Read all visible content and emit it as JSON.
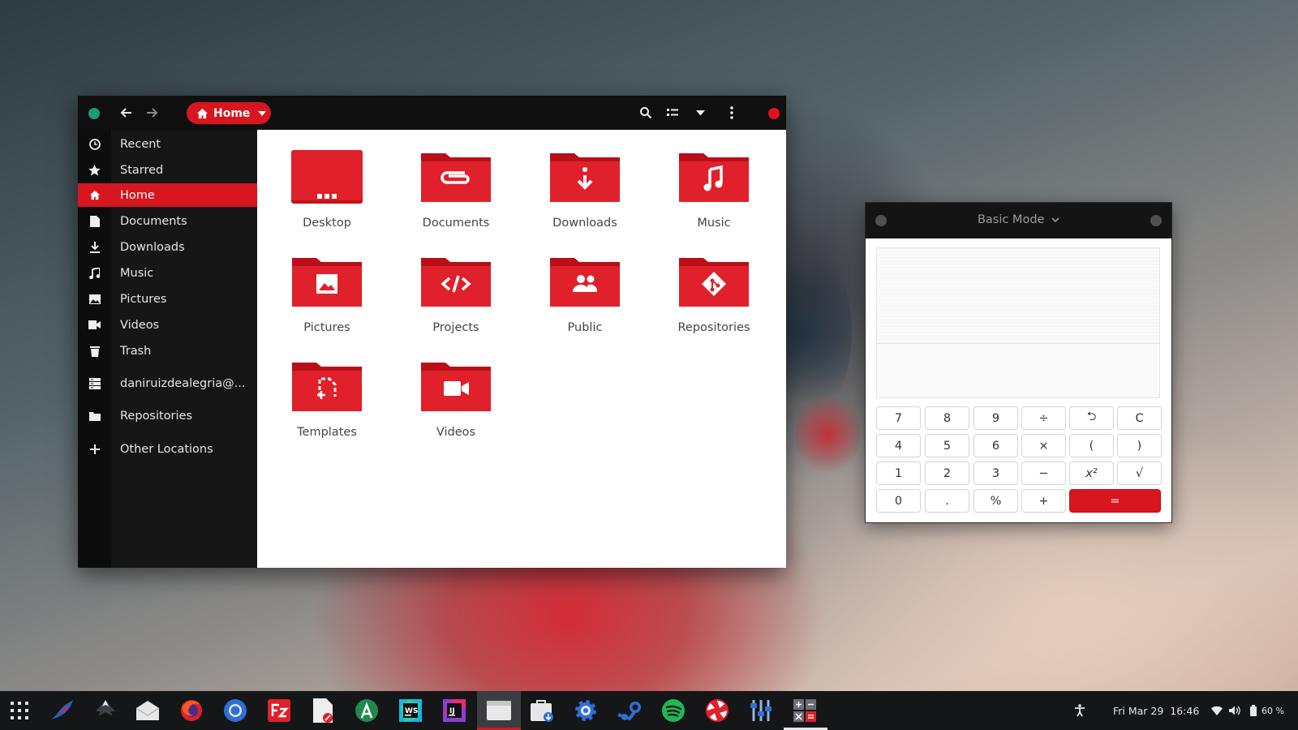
{
  "file_manager": {
    "location": "Home",
    "sidebar": [
      {
        "label": "Recent",
        "icon": "clock-icon"
      },
      {
        "label": "Starred",
        "icon": "star-icon"
      },
      {
        "label": "Home",
        "icon": "home-icon",
        "active": true
      },
      {
        "label": "Documents",
        "icon": "document-icon"
      },
      {
        "label": "Downloads",
        "icon": "download-icon"
      },
      {
        "label": "Music",
        "icon": "music-icon"
      },
      {
        "label": "Pictures",
        "icon": "picture-icon"
      },
      {
        "label": "Videos",
        "icon": "video-icon"
      },
      {
        "label": "Trash",
        "icon": "trash-icon"
      },
      {
        "label": "daniruizdealegria@...",
        "icon": "network-server-icon"
      },
      {
        "label": "Repositories",
        "icon": "folder-icon"
      },
      {
        "label": "Other Locations",
        "icon": "plus-icon"
      }
    ],
    "items": [
      {
        "label": "Desktop",
        "icon": "desktop-folder-icon"
      },
      {
        "label": "Documents",
        "icon": "documents-folder-icon"
      },
      {
        "label": "Downloads",
        "icon": "downloads-folder-icon"
      },
      {
        "label": "Music",
        "icon": "music-folder-icon"
      },
      {
        "label": "Pictures",
        "icon": "pictures-folder-icon"
      },
      {
        "label": "Projects",
        "icon": "projects-folder-icon"
      },
      {
        "label": "Public",
        "icon": "public-folder-icon"
      },
      {
        "label": "Repositories",
        "icon": "repositories-folder-icon"
      },
      {
        "label": "Templates",
        "icon": "templates-folder-icon"
      },
      {
        "label": "Videos",
        "icon": "videos-folder-icon"
      }
    ]
  },
  "calculator": {
    "mode": "Basic Mode",
    "keys": [
      [
        "7",
        "8",
        "9",
        "÷",
        "⮌",
        "C"
      ],
      [
        "4",
        "5",
        "6",
        "×",
        "(",
        ")"
      ],
      [
        "1",
        "2",
        "3",
        "−",
        "x²",
        "√"
      ],
      [
        "0",
        ".",
        "%",
        "+",
        "="
      ]
    ]
  },
  "taskbar": {
    "apps": [
      "app-grid",
      "kingfisher",
      "inkscape",
      "mail",
      "firefox",
      "chromium",
      "filezilla",
      "text-editor",
      "android-studio",
      "webstorm",
      "intellij-idea",
      "files",
      "software-install",
      "settings",
      "steam",
      "spotify",
      "ubuntu-sources",
      "tweaks",
      "calculator"
    ],
    "active_app": "files",
    "clock": "Fri Mar 29  16:46",
    "battery": "60 %"
  },
  "colors": {
    "accent": "#d7161f",
    "header": "#0f0f10",
    "sidebar": "#161616"
  }
}
